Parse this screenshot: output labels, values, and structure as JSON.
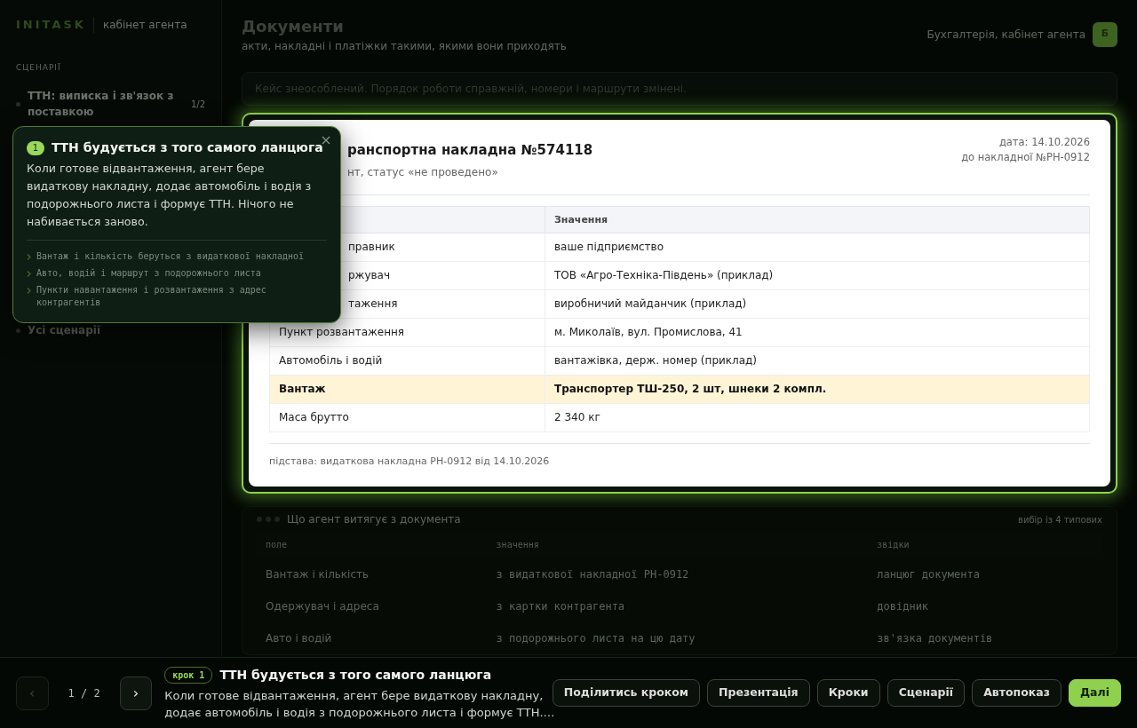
{
  "sidebar": {
    "logo": "INITASK",
    "subtitle": "кабінет агента",
    "section_title": "СЦЕНАРІЇ",
    "items": [
      {
        "label": "ТТН: виписка і зв'язок з поставкою",
        "count": "1/2",
        "selected": true
      }
    ],
    "all_link": "Усі сценарії"
  },
  "header": {
    "title": "Документи",
    "subtitle": "акти, накладні і платіжки такими, якими вони приходять",
    "user": "Бухгалтерія, кабінет агента",
    "avatar": "Б"
  },
  "notice": "Кейс знеособлений. Порядок роботи справжній, номери і маршрути змінені.",
  "document": {
    "title": "ранспортна накладна №574118",
    "subtitle": "нт, статус «не проведено»",
    "date": "дата: 14.10.2026",
    "reference": "до накладної №РН-0912",
    "value_column": "Значення",
    "rows": [
      {
        "field": "правник",
        "value": "ваше підприємство",
        "highlighted": false,
        "covered": true
      },
      {
        "field": "ржувач",
        "value": "ТОВ «Агро-Техніка-Південь» (приклад)",
        "highlighted": false,
        "covered": true
      },
      {
        "field": "таження",
        "value": "виробничий майданчик (приклад)",
        "highlighted": false,
        "covered": true
      },
      {
        "field": "Пункт розвантаження",
        "value": "м. Миколаїв, вул. Промислова, 41",
        "highlighted": false,
        "covered": false
      },
      {
        "field": "Автомобіль і водій",
        "value": "вантажівка, держ. номер (приклад)",
        "highlighted": false,
        "covered": false
      },
      {
        "field": "Вантаж",
        "value": "Транспортер ТШ-250, 2 шт, шнеки 2 компл.",
        "highlighted": true,
        "covered": false
      },
      {
        "field": "Маса брутто",
        "value": "2 340 кг",
        "highlighted": false,
        "covered": false
      }
    ],
    "footer": "підстава: видаткова накладна РН-0912 від 14.10.2026"
  },
  "extract_panel": {
    "title": "Що агент витягує з документа",
    "note": "вибір із 4 типових",
    "columns": [
      "поле",
      "значення",
      "звідки"
    ],
    "rows": [
      [
        "Вантаж і кількість",
        "з видаткової накладної РН-0912",
        "ланцюг документа"
      ],
      [
        "Одержувач і адреса",
        "з картки контрагента",
        "довідник"
      ],
      [
        "Авто і водій",
        "з подорожнього листа на цю дату",
        "зв'язка документів"
      ]
    ]
  },
  "popover": {
    "number": "1",
    "title": "ТТН будується з того самого ланцюга",
    "body": "Коли готове відвантаження, агент бере видаткову накладну, додає автомобіль і водія з подорожнього листа і формує ТТН. Нічого не набивається заново.",
    "points": [
      "Вантаж і кількість беруться з видаткової накладної",
      "Авто, водій і маршрут з подорожнього листа",
      "Пункти навантаження і розвантаження з адрес контрагентів"
    ]
  },
  "tour_bar": {
    "prev": {
      "label": "‹",
      "disabled": true
    },
    "counter": "1 / 2",
    "next": {
      "label": "›",
      "disabled": false
    },
    "step_badge": "крок 1",
    "title": "ТТН будується з того самого ланцюга",
    "description": "Коли готове відвантаження, агент бере видаткову накладну, додає автомобіль і водія з подорожнього листа і формує ТТН.…",
    "buttons": [
      {
        "label": "Поділитись кроком",
        "primary": false
      },
      {
        "label": "Презентація",
        "primary": false
      },
      {
        "label": "Кроки",
        "primary": false
      },
      {
        "label": "Сценарії",
        "primary": false
      },
      {
        "label": "Автопоказ",
        "primary": false
      },
      {
        "label": "Далі",
        "primary": true
      }
    ]
  }
}
